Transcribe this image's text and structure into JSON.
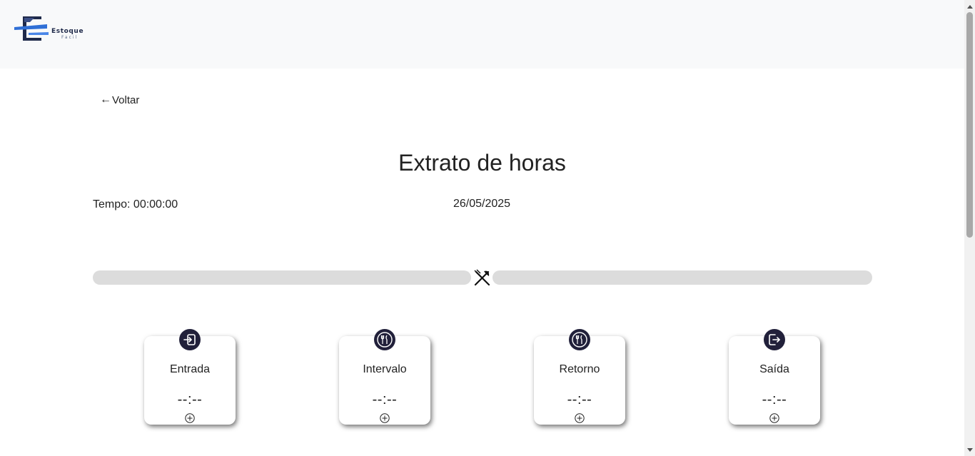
{
  "header": {
    "logo_name": "logo",
    "logo_word": "Estoque",
    "logo_sub": "Facil",
    "background": "#f8f9fa"
  },
  "nav": {
    "back_arrow": "←",
    "back_label": "Voltar"
  },
  "page": {
    "title": "Extrato de horas",
    "tempo": "Tempo: 00:00:00",
    "date": "26/05/2025"
  },
  "timeline": {
    "center_icon": "meal-icon",
    "bar_color": "#dcdcdc"
  },
  "cards": [
    {
      "label": "Entrada",
      "time": "--:--",
      "icon": "login-icon"
    },
    {
      "label": "Intervalo",
      "time": "--:--",
      "icon": "meal-icon"
    },
    {
      "label": "Retorno",
      "time": "--:--",
      "icon": "meal-icon"
    },
    {
      "label": "Saída",
      "time": "--:--",
      "icon": "logout-icon"
    }
  ],
  "colors": {
    "badge": "#21203a",
    "logo_dark": "#1f2a4a",
    "logo_blue": "#2f6fd6"
  }
}
